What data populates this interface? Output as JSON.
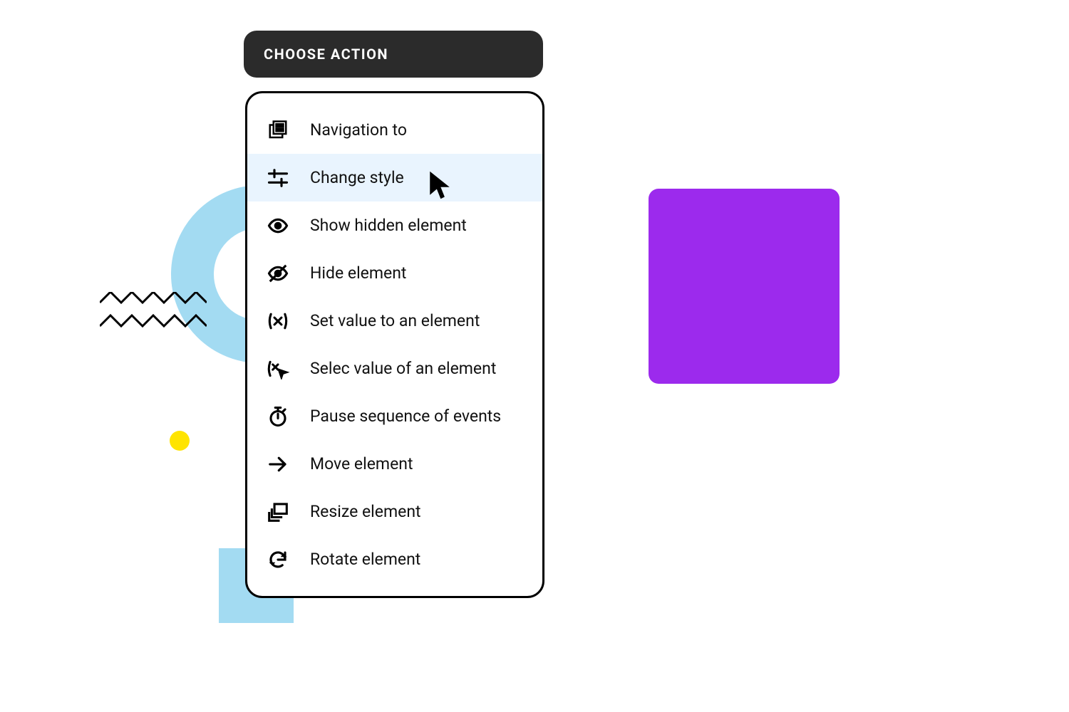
{
  "header": {
    "title": "CHOOSE ACTION"
  },
  "menu": {
    "items": [
      {
        "label": "Navigation to",
        "icon": "navigation-icon",
        "highlight": false
      },
      {
        "label": "Change style",
        "icon": "sliders-icon",
        "highlight": true
      },
      {
        "label": "Show hidden element",
        "icon": "eye-icon",
        "highlight": false
      },
      {
        "label": "Hide element",
        "icon": "eye-off-icon",
        "highlight": false
      },
      {
        "label": "Set value to an element",
        "icon": "set-value-icon",
        "highlight": false
      },
      {
        "label": "Selec value of an element",
        "icon": "select-value-icon",
        "highlight": false
      },
      {
        "label": "Pause sequence of events",
        "icon": "timer-icon",
        "highlight": false
      },
      {
        "label": "Move element",
        "icon": "arrow-right-icon",
        "highlight": false
      },
      {
        "label": "Resize element",
        "icon": "resize-icon",
        "highlight": false
      },
      {
        "label": "Rotate element",
        "icon": "rotate-icon",
        "highlight": false
      }
    ]
  },
  "colors": {
    "header_bg": "#2b2b2b",
    "highlight_bg": "#e9f4fe",
    "purple": "#9c2aed",
    "cyan": "#a3dbf2",
    "yellow": "#ffe400"
  }
}
